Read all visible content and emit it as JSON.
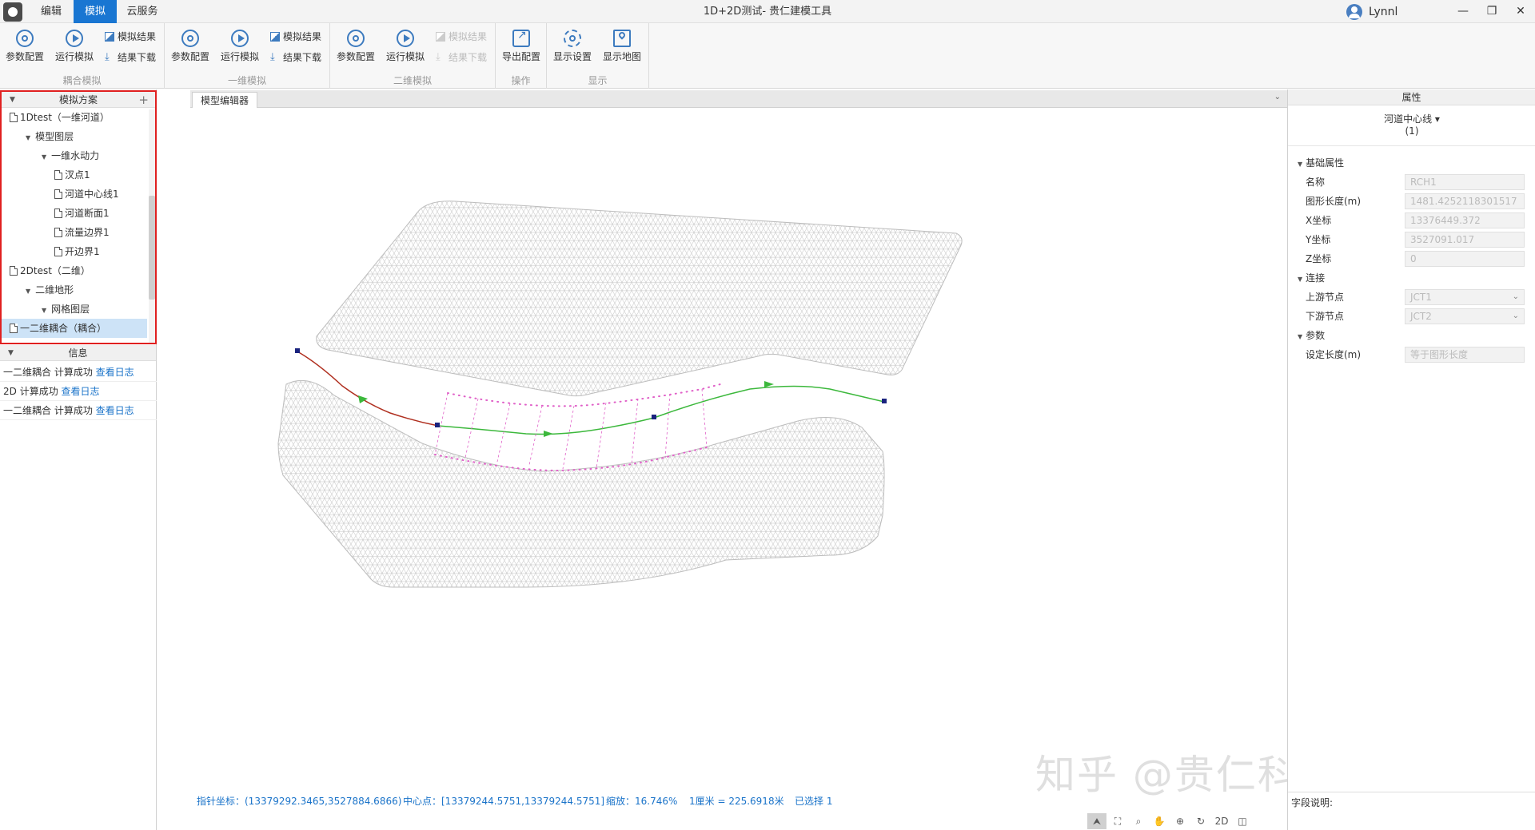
{
  "app": {
    "window_title": "1D+2D测试- 贵仁建模工具",
    "menu_tabs": [
      "编辑",
      "模拟",
      "云服务"
    ],
    "active_tab": "模拟",
    "user": "Lynnl",
    "window_buttons": [
      "—",
      "❐",
      "✕"
    ]
  },
  "ribbon": {
    "groups": [
      {
        "label": "耦合模拟",
        "param": "参数配置",
        "run": "运行模拟",
        "result": "模拟结果",
        "download": "结果下载"
      },
      {
        "label": "一维模拟",
        "param": "参数配置",
        "run": "运行模拟",
        "result": "模拟结果",
        "download": "结果下载"
      },
      {
        "label": "二维模拟",
        "param": "参数配置",
        "run": "运行模拟",
        "result": "模拟结果",
        "download": "结果下载"
      },
      {
        "label": "操作",
        "export": "导出配置"
      },
      {
        "label": "显示",
        "display": "显示设置",
        "map": "显示地图"
      }
    ]
  },
  "left_panel": {
    "scheme_title": "模拟方案",
    "tree": [
      {
        "label": "1Dtest（一维河道）",
        "type": "doc",
        "level": 0
      },
      {
        "label": "模型图层",
        "type": "folder",
        "level": 1
      },
      {
        "label": "一维水动力",
        "type": "folder",
        "level": 2
      },
      {
        "label": "汊点1",
        "type": "doc",
        "level": 3
      },
      {
        "label": "河道中心线1",
        "type": "doc",
        "level": 3
      },
      {
        "label": "河道断面1",
        "type": "doc",
        "level": 3
      },
      {
        "label": "流量边界1",
        "type": "doc",
        "level": 3
      },
      {
        "label": "开边界1",
        "type": "doc",
        "level": 3
      },
      {
        "label": "2Dtest（二维）",
        "type": "doc",
        "level": 0
      },
      {
        "label": "二维地形",
        "type": "folder",
        "level": 1
      },
      {
        "label": "网格图层",
        "type": "folder",
        "level": 2
      },
      {
        "label": "一二维耦合（耦合）",
        "type": "doc",
        "level": 0,
        "selected": true
      }
    ],
    "info_title": "信息",
    "info": [
      {
        "text": "一二维耦合 计算成功",
        "link": "查看日志"
      },
      {
        "text": "2D 计算成功",
        "link": "查看日志"
      },
      {
        "text": "一二维耦合 计算成功",
        "link": "查看日志"
      }
    ]
  },
  "editor": {
    "tab": "模型编辑器",
    "status": {
      "pointer": "指针坐标：(13379292.3465,3527884.6866)",
      "center": "中心点：[13379244.5751,13379244.5751]",
      "zoom": "缩放：16.746%",
      "scale": "1厘米 = 225.6918米",
      "selected": "已选择 1"
    },
    "toolbar": [
      "select-tool",
      "fit-tool",
      "zoom-tool",
      "pan-tool",
      "zoom-in-tool",
      "refresh-tool",
      "2d-tool",
      "split-tool"
    ],
    "toolbar_2d_label": "2D"
  },
  "watermark": "知乎 @贵仁科技模型云",
  "properties": {
    "title": "属性",
    "object_type": "河道中心线 ▾",
    "count": "(1)",
    "sections": [
      {
        "title": "基础属性",
        "rows": [
          {
            "label": "名称",
            "value": "RCH1"
          },
          {
            "label": "图形长度(m)",
            "value": "1481.4252118301517"
          },
          {
            "label": "X坐标",
            "value": "13376449.372"
          },
          {
            "label": "Y坐标",
            "value": "3527091.017"
          },
          {
            "label": "Z坐标",
            "value": "0"
          }
        ]
      },
      {
        "title": "连接",
        "rows": [
          {
            "label": "上游节点",
            "value": "JCT1",
            "dropdown": true
          },
          {
            "label": "下游节点",
            "value": "JCT2",
            "dropdown": true
          }
        ]
      },
      {
        "title": "参数",
        "rows": [
          {
            "label": "设定长度(m)",
            "value": "等于图形长度"
          }
        ]
      }
    ],
    "field_desc": "字段说明:"
  },
  "colors": {
    "accent": "#1976d2",
    "highlight_box": "#e02020",
    "river_upstream": "#b03020",
    "river_downstream": "#3cb83c",
    "cross_section": "#e060c8",
    "mesh": "#bdbdbd"
  }
}
